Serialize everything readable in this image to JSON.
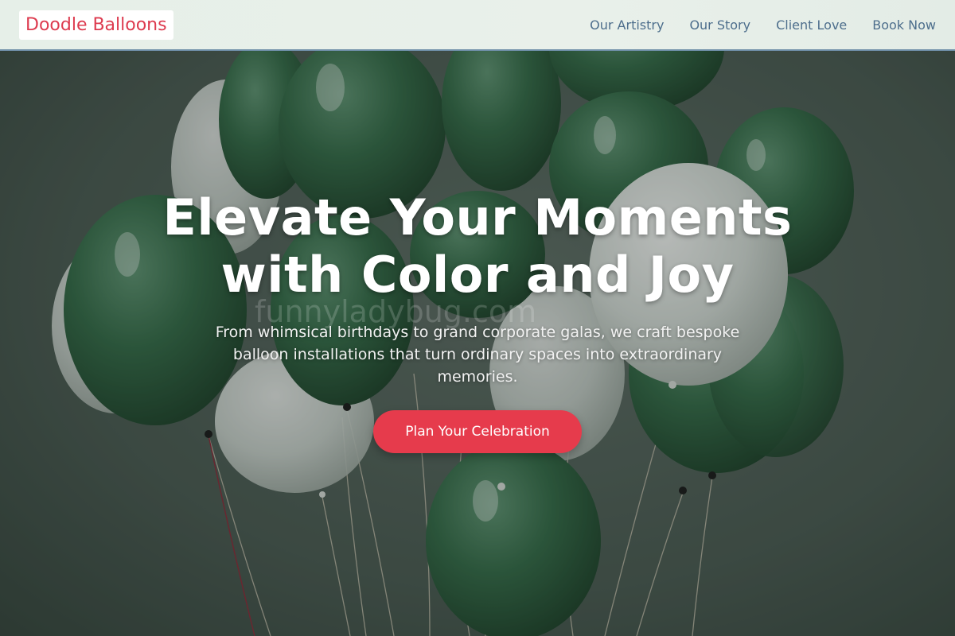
{
  "navbar": {
    "brand": "Doodle Balloons",
    "links": [
      {
        "label": "Our Artistry"
      },
      {
        "label": "Our Story"
      },
      {
        "label": "Client Love"
      },
      {
        "label": "Book Now"
      }
    ]
  },
  "hero": {
    "title_line1": "Elevate Your Moments",
    "title_line2": "with Color and Joy",
    "subtitle": "From whimsical birthdays to grand corporate galas, we craft bespoke balloon installations that turn ordinary spaces into extraordinary memories.",
    "cta_label": "Plan Your Celebration",
    "background_image": "green-and-white-balloon-bouquet",
    "watermark": "funnyladybug.com"
  },
  "colors": {
    "brand": "#dd3b4f",
    "nav_link": "#4d6e8c",
    "cta": "#e63b4c",
    "balloon_green": "#2f5e40",
    "balloon_white": "#dfe5e0"
  }
}
